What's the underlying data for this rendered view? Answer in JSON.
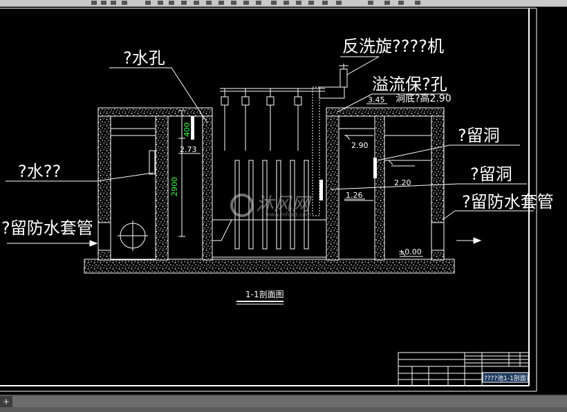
{
  "labels": {
    "backwash_fan": "反洗旋????机",
    "overflow_hole": "溢流保?孔",
    "overflow_bottom": "洞底?高2.90",
    "inlet_hole": "?水孔",
    "outlet": "?水??",
    "reserved_hole_1": "?留洞",
    "reserved_hole_2": "?留洞",
    "sleeve_left": "?留防水套管",
    "sleeve_right": "?留防水套管"
  },
  "dimensions": {
    "d400": "400",
    "d2900": "2900",
    "e273": "2.73",
    "e345": "3.45",
    "e290": "2.90",
    "e220": "2.20",
    "e126": "1.26",
    "e000": "±0.00"
  },
  "section_title": "1-1剖面图",
  "title_block": {
    "drawing_name": "????池1-1剖面?"
  },
  "watermark": {
    "text": "沐风网",
    "url": "www.mfcad.com"
  },
  "statusbar": {
    "add_tab": "+"
  }
}
